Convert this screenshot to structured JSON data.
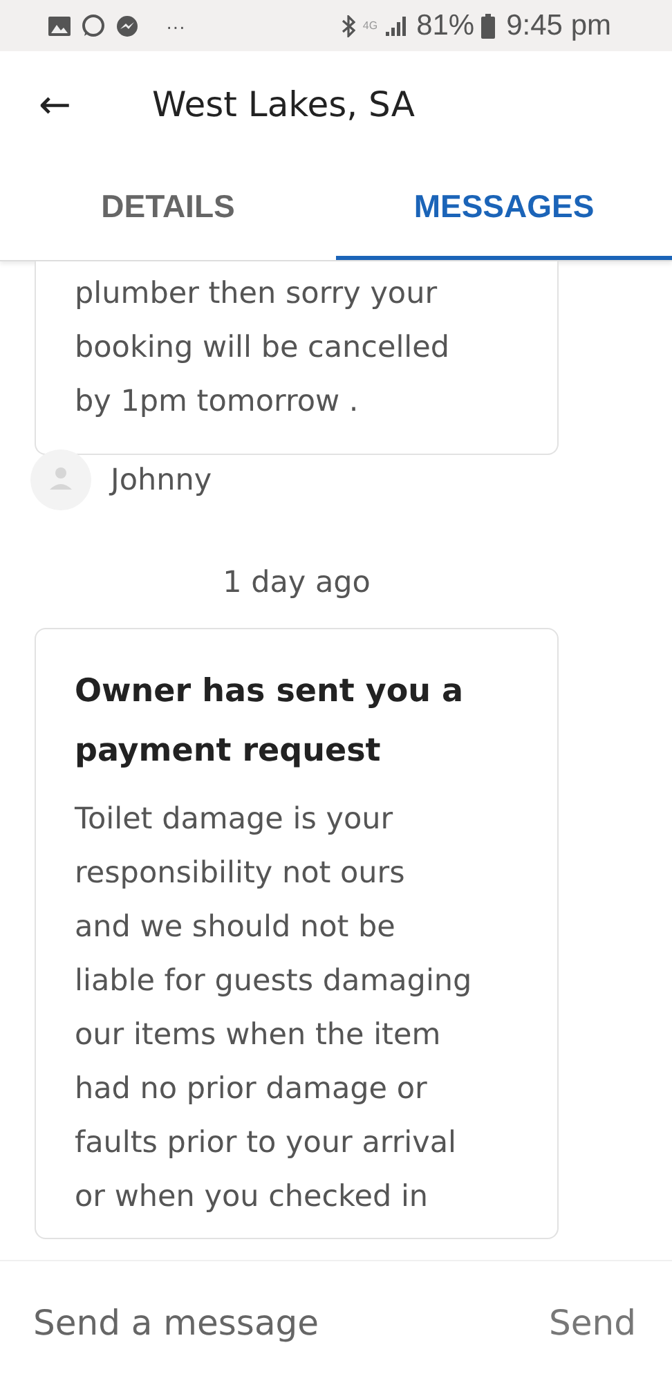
{
  "status_bar": {
    "time": "9:45 pm",
    "battery": "81%",
    "network": "4G",
    "more": "···"
  },
  "header": {
    "back": "←",
    "title": "West Lakes, SA"
  },
  "tabs": [
    {
      "label": "DETAILS",
      "selected": false
    },
    {
      "label": "MESSAGES",
      "selected": true
    }
  ],
  "messages": [
    {
      "kind": "text",
      "body": "plumber then sorry your\nbooking will be cancelled\nby 1pm tomorrow .",
      "sender": "Johnny"
    },
    {
      "kind": "divider",
      "text": "1 day ago"
    },
    {
      "kind": "request",
      "title": "Owner has sent you a\npayment request",
      "body": "Toilet damage is your\nresponsibility not ours\nand we should not be\nliable for guests damaging\nour items when the item\nhad no prior damage or\nfaults prior to your arrival\nor when you checked in"
    }
  ],
  "composer": {
    "placeholder": "Send a message",
    "send": "Send"
  }
}
